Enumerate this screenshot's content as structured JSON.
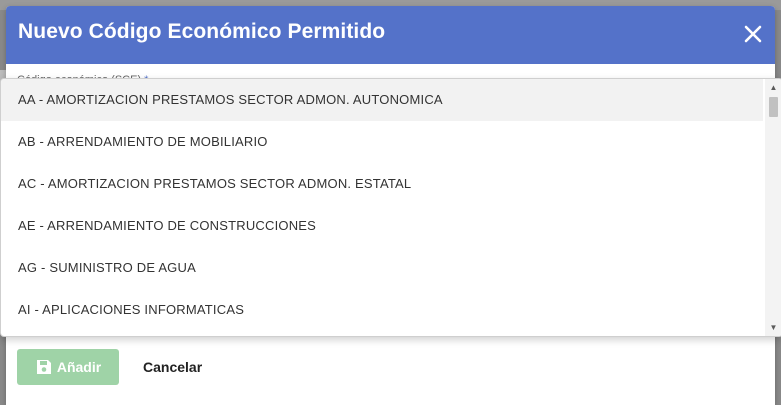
{
  "dialog": {
    "title": "Nuevo Código Económico Permitido",
    "field_label": "Código económico (SCE)",
    "required_mark": "*"
  },
  "dropdown": {
    "options": [
      "AA - AMORTIZACION PRESTAMOS SECTOR ADMON. AUTONOMICA",
      "AB - ARRENDAMIENTO DE MOBILIARIO",
      "AC - AMORTIZACION PRESTAMOS SECTOR ADMON. ESTATAL",
      "AE - ARRENDAMIENTO DE CONSTRUCCIONES",
      "AG - SUMINISTRO DE AGUA",
      "AI - APLICACIONES INFORMATICAS"
    ],
    "highlighted_index": 0
  },
  "footer": {
    "add_label": "Añadir",
    "cancel_label": "Cancelar"
  },
  "colors": {
    "header": "#5472c9",
    "add_button": "#9fd3a7"
  },
  "icons": {
    "close": "close-icon",
    "save": "save-icon",
    "scroll_up": "scroll-up-icon",
    "scroll_down": "scroll-down-icon"
  }
}
